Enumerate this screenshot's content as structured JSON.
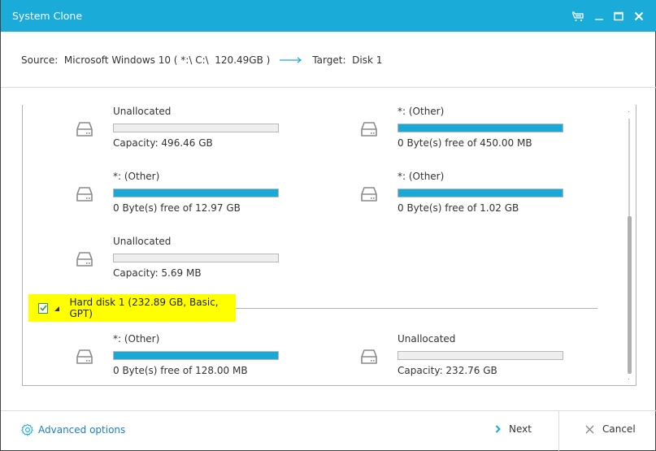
{
  "window": {
    "title": "System Clone",
    "controls": [
      "cart-icon",
      "minimize-icon",
      "maximize-icon",
      "close-icon"
    ]
  },
  "clone": {
    "source_label": "Source:",
    "source_value": "Microsoft Windows 10 ( *:\\ C:\\  120.49GB )",
    "target_label": "Target:",
    "target_value": "Disk 1"
  },
  "partitions_top": [
    {
      "name": "Unallocated",
      "info": "Capacity: 496.46 GB",
      "used_fraction": 0
    },
    {
      "name": "*: (Other)",
      "info": "0 Byte(s) free of 450.00 MB",
      "used_fraction": 1
    },
    {
      "name": "*: (Other)",
      "info": "0 Byte(s) free of 12.97 GB",
      "used_fraction": 1
    },
    {
      "name": "*: (Other)",
      "info": "0 Byte(s) free of 1.02 GB",
      "used_fraction": 1
    },
    {
      "name": "Unallocated",
      "info": "Capacity: 5.69 MB",
      "used_fraction": 0
    }
  ],
  "disk": {
    "label": "Hard disk 1 (232.89 GB, Basic, GPT)",
    "checked": true,
    "partitions": [
      {
        "name": "*: (Other)",
        "info": "0 Byte(s) free of 128.00 MB",
        "used_fraction": 1
      },
      {
        "name": "Unallocated",
        "info": "Capacity: 232.76 GB",
        "used_fraction": 0
      }
    ]
  },
  "footer": {
    "advanced_label": "Advanced options",
    "next_label": "Next",
    "cancel_label": "Cancel"
  },
  "colors": {
    "accent": "#1aabd9",
    "highlight": "#ffff00",
    "link": "#1c7fc0"
  }
}
